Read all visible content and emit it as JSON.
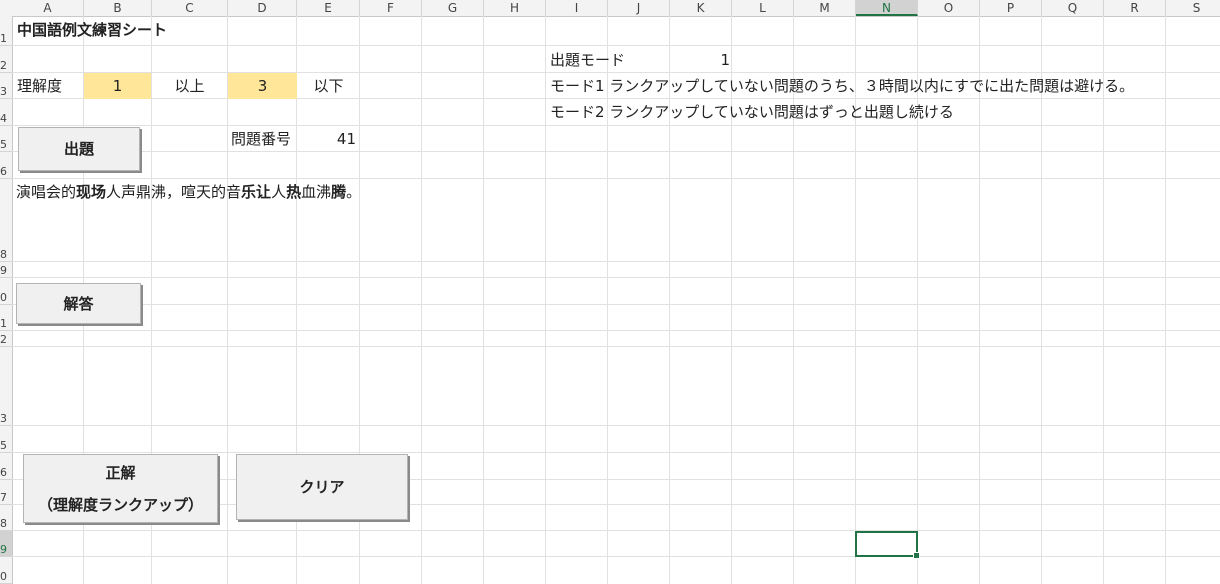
{
  "columns": [
    "A",
    "B",
    "C",
    "D",
    "E",
    "F",
    "G",
    "H",
    "I",
    "J",
    "K",
    "L",
    "M",
    "N",
    "O",
    "P",
    "Q",
    "R",
    "S"
  ],
  "active_column": "N",
  "rows": [
    "1",
    "2",
    "3",
    "4",
    "5",
    "6",
    "8",
    "9",
    "0",
    "1",
    "2",
    "3",
    "5",
    "6",
    "7",
    "8",
    "9",
    "0"
  ],
  "active_row": "9",
  "sheet": {
    "title": "中国語例文練習シート",
    "understanding_label": "理解度",
    "understanding_min": "1",
    "above_label": "以上",
    "understanding_max": "3",
    "below_label": "以下",
    "question_number_label": "問題番号",
    "question_number": "41",
    "mode_label": "出題モード",
    "mode_value": "1",
    "mode1_description": "モード1 ランクアップしていない問題のうち、３時間以内にすでに出た問題は避ける。",
    "mode2_description": "モード2 ランクアップしていない問題はずっと出題し続ける",
    "sentence_segments": [
      {
        "text": "演唱会的",
        "bold": false
      },
      {
        "text": "现场",
        "bold": true
      },
      {
        "text": "人声鼎沸，喧天的音",
        "bold": false
      },
      {
        "text": "乐让",
        "bold": true
      },
      {
        "text": "人",
        "bold": false
      },
      {
        "text": "热",
        "bold": true
      },
      {
        "text": "血沸",
        "bold": false
      },
      {
        "text": "腾",
        "bold": true
      },
      {
        "text": "。",
        "bold": false
      }
    ]
  },
  "buttons": {
    "question": "出題",
    "answer": "解答",
    "correct_line1": "正解",
    "correct_line2": "（理解度ランクアップ）",
    "clear": "クリア"
  },
  "colors": {
    "highlight": "#ffe699",
    "selection": "#217346"
  }
}
